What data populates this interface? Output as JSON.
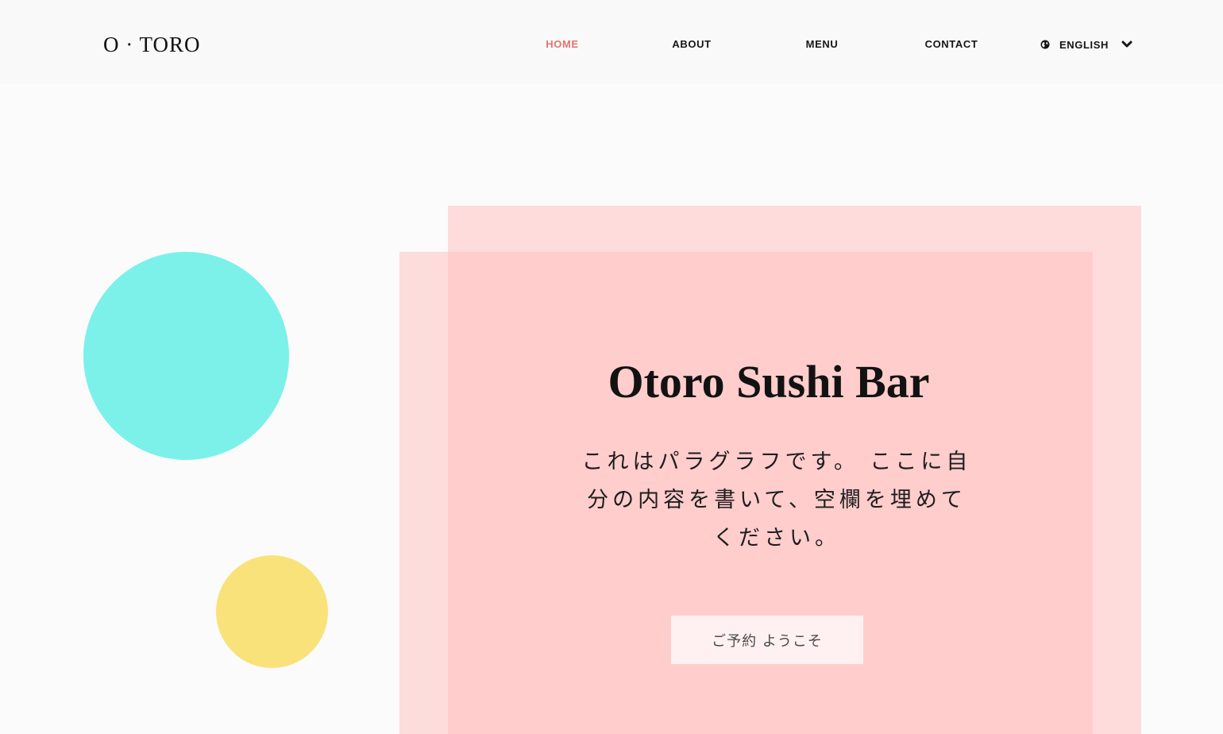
{
  "header": {
    "logo": "O · TORO",
    "nav": [
      {
        "label": "HOME",
        "active": true
      },
      {
        "label": "ABOUT",
        "active": false
      },
      {
        "label": "MENU",
        "active": false
      },
      {
        "label": "CONTACT",
        "active": false
      }
    ],
    "language": {
      "label": "ENGLISH",
      "icon": "globe-icon",
      "dropdown_icon": "chevron-down-icon"
    }
  },
  "hero": {
    "title": "Otoro Sushi Bar",
    "paragraph": "これはパラグラフです。 ここに自分の内容を書いて、空欄を埋めてください。",
    "cta_label": "ご予約 ようこそ"
  },
  "colors": {
    "accent": "#e57373",
    "cyan_circle": "#7bf1ea",
    "yellow_circle": "#fae27a",
    "pink_panel": "#ffcdcc",
    "pink_panel_light": "#fedcdb"
  }
}
